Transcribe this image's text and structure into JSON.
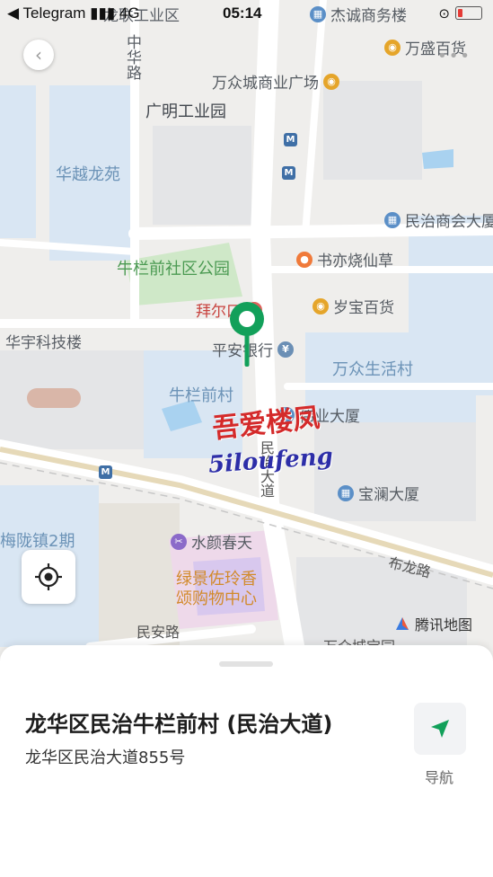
{
  "status_bar": {
    "carrier": "◀ Telegram ▮▮▮ 4G",
    "time": "05:14"
  },
  "map": {
    "areas": [
      "龙联工业区",
      "中华路",
      "广明工业园",
      "华越龙苑",
      "牛栏前社区公园",
      "华宇科技楼",
      "牛栏前村",
      "万众生活村",
      "梅陇镇2期",
      "民安路"
    ],
    "pois": {
      "jiecheng": "杰诚商务楼",
      "wansheng": "万盛百货",
      "wanzhong": "万众城商业广场",
      "minzhi": "民治商会大厦",
      "shuyi": "书亦烧仙草",
      "suibao": "岁宝百货",
      "baier": "拜尔口",
      "pingan": "平安银行",
      "weiye": "伟业大厦",
      "baolan": "宝澜大厦",
      "shuiyan": "水颜春天",
      "lvjing": "绿景佐玲香颂购物中心",
      "wanzhongcheng": "万众城宝园"
    },
    "roads": {
      "minzhi_avenue": "民治大道",
      "bulong": "布龙路"
    },
    "watermark_cn": "吾爱楼凤",
    "watermark_en": "5iloufeng",
    "brand": "腾讯地图"
  },
  "sheet": {
    "title": "龙华区民治牛栏前村 (民治大道)",
    "address": "龙华区民治大道855号",
    "nav_label": "导航"
  }
}
